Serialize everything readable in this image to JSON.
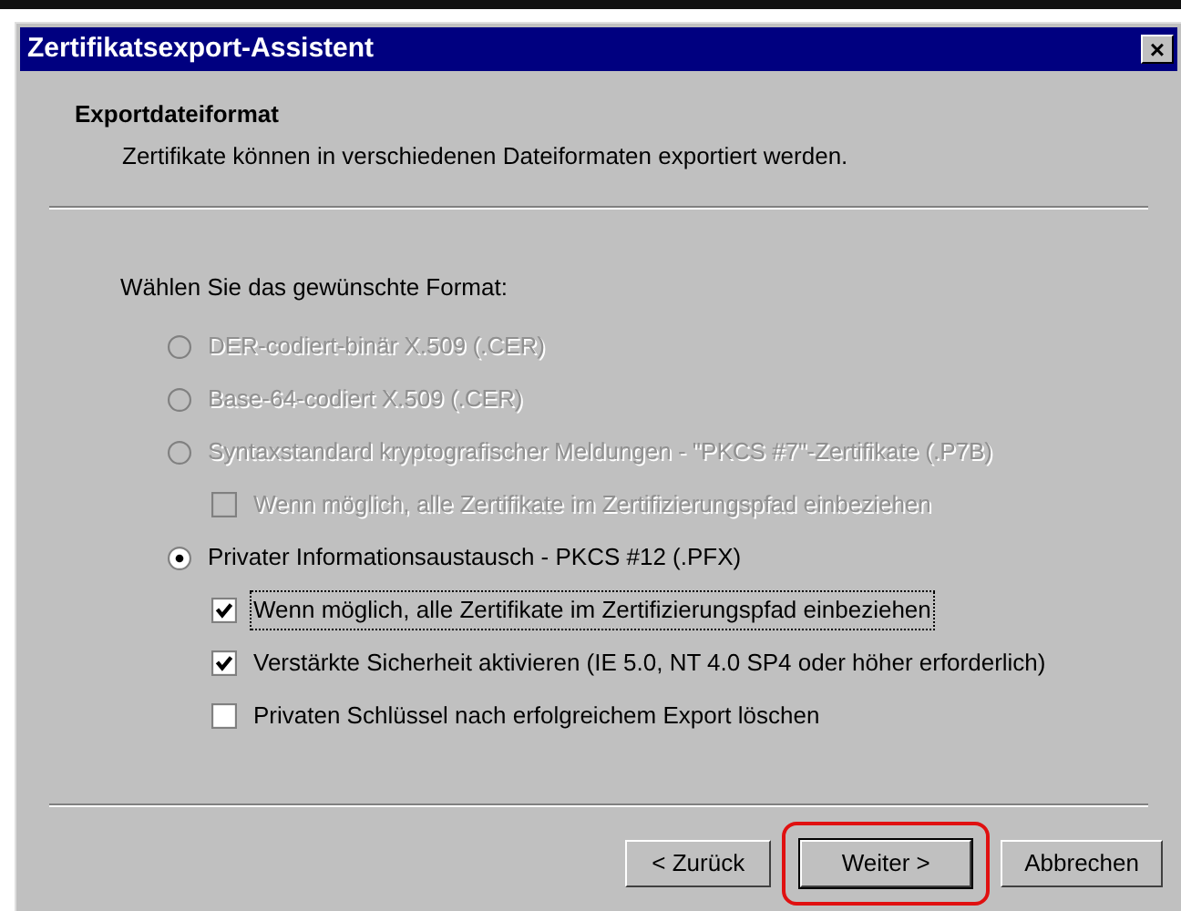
{
  "window": {
    "title": "Zertifikatsexport-Assistent",
    "close": "×"
  },
  "header": {
    "title": "Exportdateiformat",
    "subtitle": "Zertifikate können in verschiedenen Dateiformaten exportiert werden."
  },
  "prompt": "Wählen Sie das gewünschte Format:",
  "options": [
    {
      "kind": "radio",
      "label": "DER-codiert-binär X.509 (.CER)",
      "selected": false,
      "disabled": true
    },
    {
      "kind": "radio",
      "label": "Base-64-codiert X.509 (.CER)",
      "selected": false,
      "disabled": true
    },
    {
      "kind": "radio",
      "label": "Syntaxstandard kryptografischer Meldungen - \"PKCS #7\"-Zertifikate (.P7B)",
      "selected": false,
      "disabled": true,
      "children": [
        {
          "kind": "checkbox",
          "label": "Wenn möglich, alle Zertifikate im Zertifizierungspfad einbeziehen",
          "checked": false,
          "disabled": true,
          "focused": false
        }
      ]
    },
    {
      "kind": "radio",
      "label": "Privater Informationsaustausch - PKCS #12 (.PFX)",
      "selected": true,
      "disabled": false,
      "children": [
        {
          "kind": "checkbox",
          "label": "Wenn möglich, alle Zertifikate im Zertifizierungspfad einbeziehen",
          "checked": true,
          "disabled": false,
          "focused": true
        },
        {
          "kind": "checkbox",
          "label": "Verstärkte Sicherheit aktivieren (IE 5.0, NT 4.0 SP4 oder höher erforderlich)",
          "checked": true,
          "disabled": false,
          "focused": false
        },
        {
          "kind": "checkbox",
          "label": "Privaten Schlüssel nach erfolgreichem Export löschen",
          "checked": false,
          "disabled": false,
          "focused": false
        }
      ]
    }
  ],
  "buttons": [
    {
      "label": "< Zurück",
      "default": false,
      "highlighted": false
    },
    {
      "label": "Weiter >",
      "default": true,
      "highlighted": true
    },
    {
      "label": "Abbrechen",
      "default": false,
      "highlighted": false
    }
  ]
}
